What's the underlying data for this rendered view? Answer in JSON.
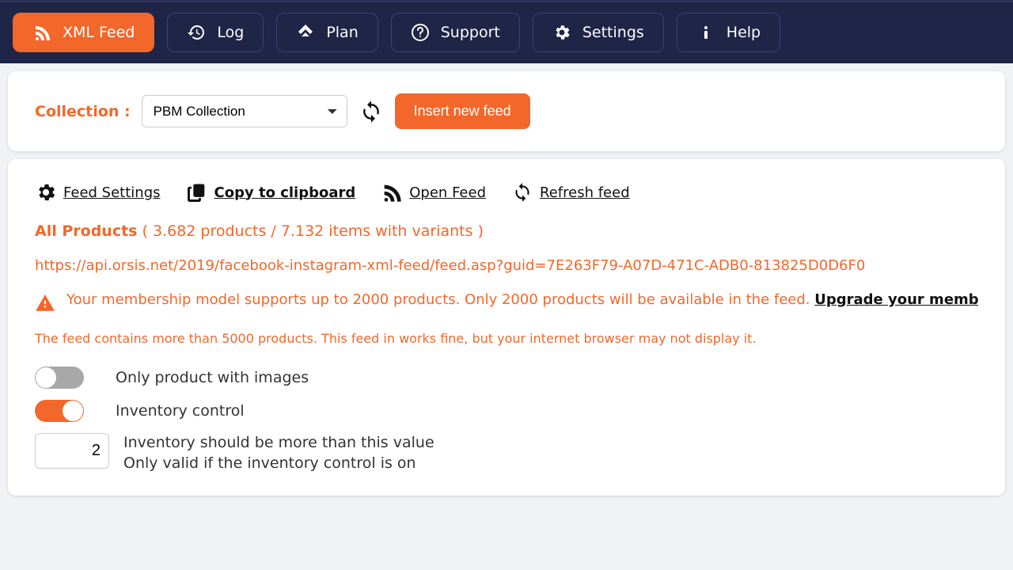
{
  "nav": {
    "xml_feed": "XML Feed",
    "log": "Log",
    "plan": "Plan",
    "support": "Support",
    "settings": "Settings",
    "help": "Help"
  },
  "collection": {
    "label": "Collection :",
    "selected": "PBM Collection",
    "insert_btn": "Insert new feed"
  },
  "actions": {
    "feed_settings": "Feed Settings",
    "copy": "Copy to clipboard",
    "open_feed": "Open Feed",
    "refresh_feed": "Refresh feed"
  },
  "products": {
    "prefix": "All Products",
    "stats": " ( 3.682 products / 7.132 items with variants )"
  },
  "feed_url": "https://api.orsis.net/2019/facebook-instagram-xml-feed/feed.asp?guid=7E263F79-A07D-471C-ADB0-813825D0D6F0",
  "warning": {
    "text": "Your membership model supports up to 2000 products. Only 2000 products will be available in the feed. ",
    "link": "Upgrade your membership model for m"
  },
  "browser_note": "The feed contains more than 5000 products. This feed in works fine, but your internet browser may not display it.",
  "toggles": {
    "only_images": "Only product with images",
    "inventory": "Inventory control",
    "inventory_value": "2",
    "inventory_desc1": "Inventory should be more than this value",
    "inventory_desc2": "Only valid if the inventory control is on"
  }
}
